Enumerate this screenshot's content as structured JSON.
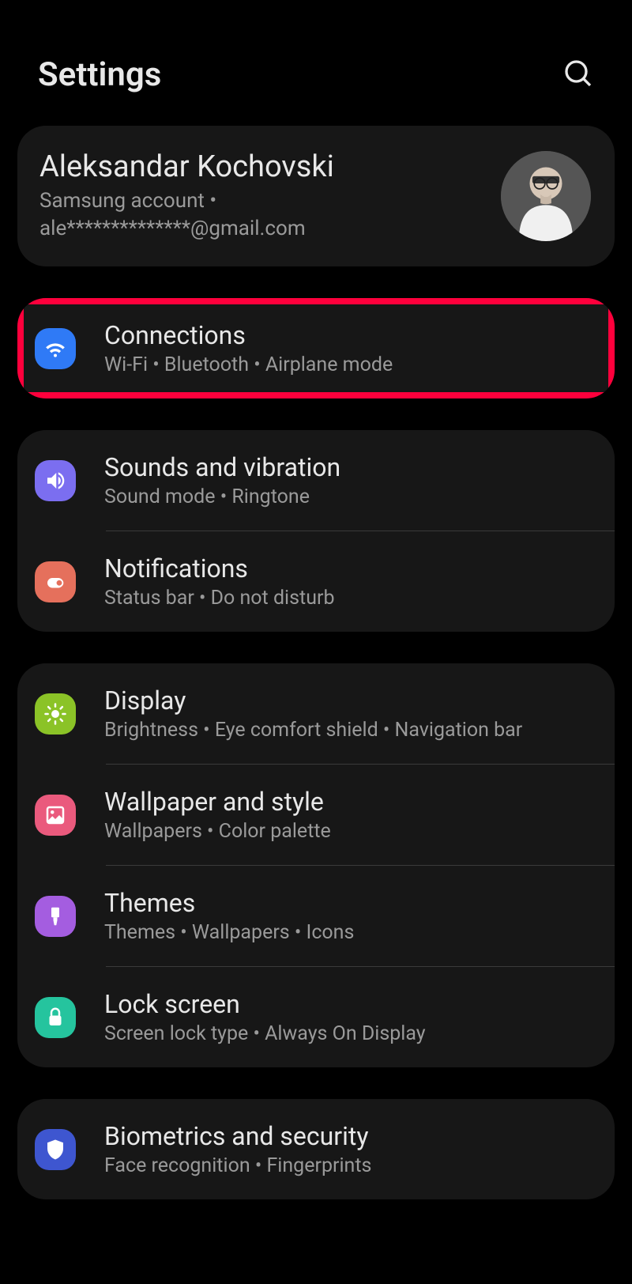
{
  "header": {
    "title": "Settings"
  },
  "account": {
    "name": "Aleksandar Kochovski",
    "subtitle": "Samsung account  •  ale**************@gmail.com"
  },
  "groups": [
    {
      "items": [
        {
          "key": "connections",
          "title": "Connections",
          "subtitle": "Wi-Fi  •  Bluetooth  •  Airplane mode",
          "color": "icon-blue",
          "icon": "wifi",
          "highlight": true
        }
      ]
    },
    {
      "items": [
        {
          "key": "sounds",
          "title": "Sounds and vibration",
          "subtitle": "Sound mode  •  Ringtone",
          "color": "icon-purple",
          "icon": "sound"
        },
        {
          "key": "notifications",
          "title": "Notifications",
          "subtitle": "Status bar  •  Do not disturb",
          "color": "icon-coral",
          "icon": "bell"
        }
      ]
    },
    {
      "items": [
        {
          "key": "display",
          "title": "Display",
          "subtitle": "Brightness  •  Eye comfort shield  •  Navigation bar",
          "color": "icon-green",
          "icon": "sun"
        },
        {
          "key": "wallpaper",
          "title": "Wallpaper and style",
          "subtitle": "Wallpapers  •  Color palette",
          "color": "icon-pink",
          "icon": "image"
        },
        {
          "key": "themes",
          "title": "Themes",
          "subtitle": "Themes  •  Wallpapers  •  Icons",
          "color": "icon-violet",
          "icon": "brush"
        },
        {
          "key": "lockscreen",
          "title": "Lock screen",
          "subtitle": "Screen lock type  •  Always On Display",
          "color": "icon-teal",
          "icon": "lock"
        }
      ]
    },
    {
      "items": [
        {
          "key": "biometrics",
          "title": "Biometrics and security",
          "subtitle": "Face recognition  •  Fingerprints",
          "color": "icon-navy",
          "icon": "shield"
        }
      ]
    }
  ]
}
